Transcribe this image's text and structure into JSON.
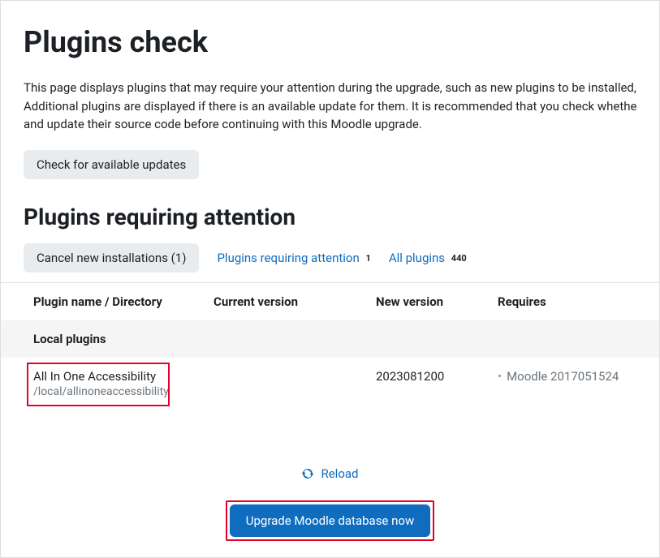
{
  "page": {
    "title": "Plugins check",
    "description_line1": "This page displays plugins that may require your attention during the upgrade, such as new plugins to be installed, plugi",
    "description_line2": "Additional plugins are displayed if there is an available update for them. It is recommended that you check whether there",
    "description_line3": "and update their source code before continuing with this Moodle upgrade."
  },
  "buttons": {
    "check_updates": "Check for available updates",
    "cancel_installations": "Cancel new installations (1)",
    "reload": "Reload",
    "upgrade": "Upgrade Moodle database now"
  },
  "section": {
    "heading": "Plugins requiring attention"
  },
  "filters": {
    "requiring_attention_label": "Plugins requiring attention",
    "requiring_attention_count": "1",
    "all_plugins_label": "All plugins",
    "all_plugins_count": "440"
  },
  "table": {
    "headers": {
      "name": "Plugin name / Directory",
      "current": "Current version",
      "new": "New version",
      "requires": "Requires"
    },
    "section_label": "Local plugins",
    "rows": [
      {
        "name": "All In One Accessibility",
        "directory": "/local/allinoneaccessibility",
        "current": "",
        "new": "2023081200",
        "requires": "Moodle 2017051524"
      }
    ]
  }
}
